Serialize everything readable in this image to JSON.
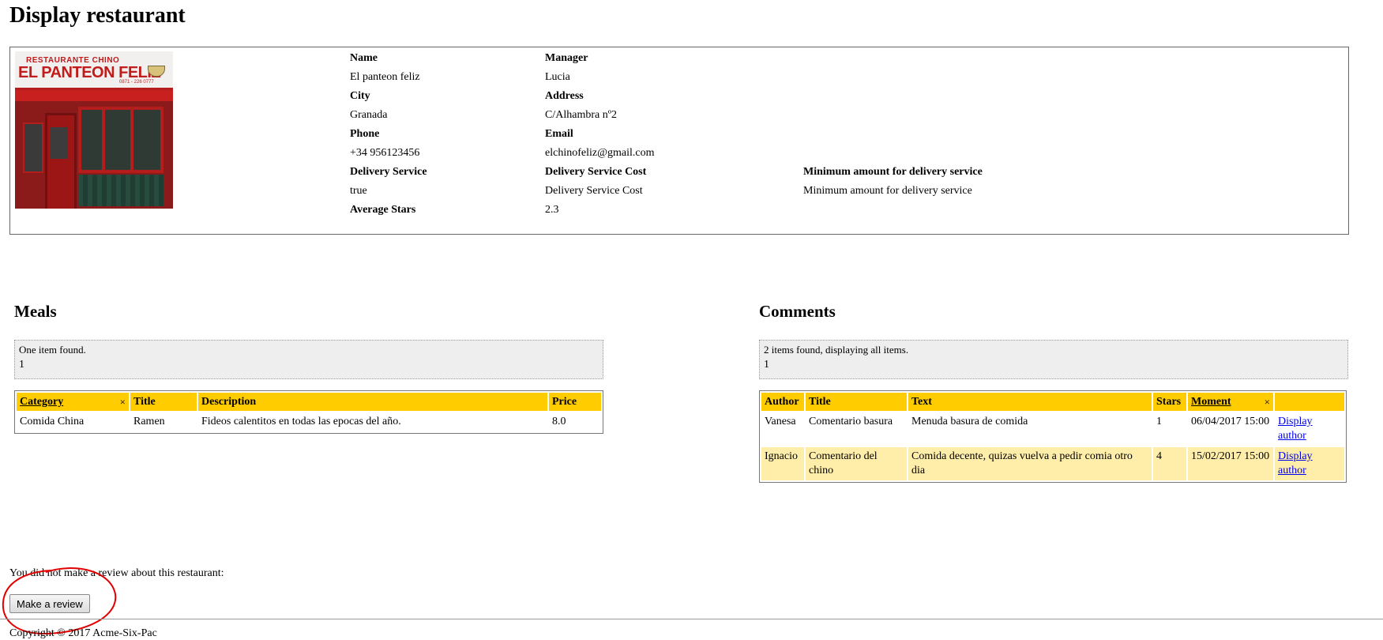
{
  "page": {
    "title": "Display restaurant"
  },
  "restaurant": {
    "photo_sign": {
      "top": "RESTAURANTE CHINO",
      "main": "EL PANTEON FELIZ",
      "phone": "0871 - 226 0777"
    },
    "labels": {
      "name": "Name",
      "manager": "Manager",
      "city": "City",
      "address": "Address",
      "phone": "Phone",
      "email": "Email",
      "delivery_service": "Delivery Service",
      "delivery_service_cost": "Delivery Service Cost",
      "minimum_amount": "Minimum amount for delivery service",
      "average_stars": "Average Stars"
    },
    "values": {
      "name": "El panteon feliz",
      "manager": "Lucia",
      "city": "Granada",
      "address": "C/Alhambra nº2",
      "phone": "+34 956123456",
      "email": "elchinofeliz@gmail.com",
      "delivery_service": "true",
      "delivery_service_cost": "Delivery Service Cost",
      "minimum_amount": "Minimum amount for delivery service",
      "average_stars": "2.3"
    }
  },
  "meals": {
    "title": "Meals",
    "pager": {
      "count": "One item found.",
      "pages": "1"
    },
    "columns": {
      "category": "Category",
      "title": "Title",
      "description": "Description",
      "price": "Price"
    },
    "sort_clear": "×",
    "rows": [
      {
        "category": "Comida China",
        "title": "Ramen",
        "description": "Fideos calentitos en todas las epocas del año.",
        "price": "8.0"
      }
    ]
  },
  "comments": {
    "title": "Comments",
    "pager": {
      "count": "2 items found, displaying all items.",
      "pages": "1"
    },
    "columns": {
      "author": "Author",
      "title": "Title",
      "text": "Text",
      "stars": "Stars",
      "moment": "Moment",
      "action": ""
    },
    "sort_clear": "×",
    "rows": [
      {
        "author": "Vanesa",
        "title": "Comentario basura",
        "text": "Menuda basura de comida",
        "stars": "1",
        "moment": "06/04/2017 15:00",
        "action": "Display author"
      },
      {
        "author": "Ignacio",
        "title": "Comentario del chino",
        "text": "Comida decente, quizas vuelva a pedir comia otro dia",
        "stars": "4",
        "moment": "15/02/2017 15:00",
        "action": "Display author"
      }
    ]
  },
  "review": {
    "message": "You did not make a review about this restaurant:",
    "button": "Make a review"
  },
  "footer": {
    "text": "Copyright © 2017 Acme-Six-Pac"
  },
  "colors": {
    "header_bg": "#ffcc00",
    "even_row_bg": "#ffeeaa",
    "annotation": "#e00000"
  }
}
